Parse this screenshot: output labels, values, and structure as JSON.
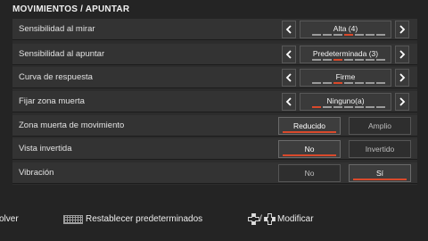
{
  "page": {
    "title": "MOVIMIENTOS / APUNTAR"
  },
  "rows": [
    {
      "label": "Sensibilidad al mirar",
      "value": "Alta (4)",
      "step": 4,
      "steps": 7
    },
    {
      "label": "Sensibilidad al apuntar",
      "value": "Predeterminada (3)",
      "step": 3,
      "steps": 7
    },
    {
      "label": "Curva de respuesta",
      "value": "Firme",
      "step": 3,
      "steps": 7
    },
    {
      "label": "Fijar zona muerta",
      "value": "Ninguno(a)",
      "step": 1,
      "steps": 7
    }
  ],
  "toggles": [
    {
      "label": "Zona muerta de movimiento",
      "options": [
        "Reducido",
        "Amplio"
      ],
      "selected": "Reducido"
    },
    {
      "label": "Vista invertida",
      "options": [
        "No",
        "Invertido"
      ],
      "selected": "No"
    },
    {
      "label": "Vibración",
      "options": [
        "No",
        "Sí"
      ],
      "selected": "Sí"
    }
  ],
  "footer": {
    "back": "olver",
    "reset": "Restablecer predeterminados",
    "modify": "Modificar",
    "modify_separator": "/"
  },
  "colors": {
    "accent": "#d9492b",
    "background": "#242424"
  }
}
